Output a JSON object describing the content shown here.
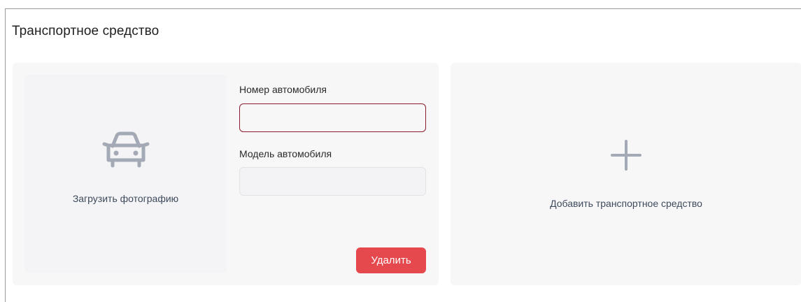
{
  "section": {
    "title": "Транспортное средство"
  },
  "vehicle_card": {
    "photo_upload_label": "Загрузить фотографию",
    "photo_icon": "car-icon",
    "number_field": {
      "label": "Номер автомобиля",
      "value": "",
      "placeholder": ""
    },
    "model_field": {
      "label": "Модель автомобиля",
      "value": "",
      "placeholder": ""
    },
    "delete_button_label": "Удалить"
  },
  "add_card": {
    "icon": "plus-icon",
    "label": "Добавить транспортное средство"
  },
  "colors": {
    "accent_danger": "#e5484d",
    "invalid_border": "#8b1c2c",
    "card_background": "#f7f7f8",
    "icon_gray": "#a3a9b5",
    "link_text": "#3d4a5c"
  }
}
